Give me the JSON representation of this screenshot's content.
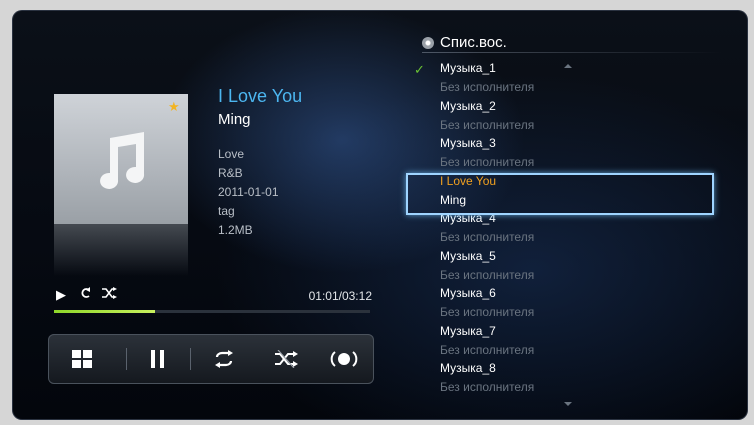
{
  "now_playing": {
    "title": "I Love You",
    "artist": "Ming",
    "album": "Love",
    "genre": "R&B",
    "date": "2011-01-01",
    "tag": "tag",
    "size": "1.2MB",
    "time_display": "01:01/03:12",
    "progress_fraction": 0.32
  },
  "status_icons": [
    "play-icon",
    "repeat-one-icon",
    "shuffle-icon"
  ],
  "controls": [
    {
      "name": "grid-view-icon"
    },
    {
      "name": "pause-icon"
    },
    {
      "name": "repeat-icon"
    },
    {
      "name": "shuffle-off-icon"
    },
    {
      "name": "sound-mode-icon"
    }
  ],
  "playlist": {
    "header": "Спис.вос.",
    "items": [
      {
        "name": "Музыка_1",
        "artist": "Без исполнителя",
        "checked": true
      },
      {
        "name": "Музыка_2",
        "artist": "Без исполнителя"
      },
      {
        "name": "Музыка_3",
        "artist": "Без исполнителя"
      },
      {
        "name": "I Love You",
        "artist": "Ming",
        "active": true
      },
      {
        "name": "Музыка_4",
        "artist": "Без исполнителя"
      },
      {
        "name": "Музыка_5",
        "artist": "Без исполнителя"
      },
      {
        "name": "Музыка_6",
        "artist": "Без исполнителя"
      },
      {
        "name": "Музыка_7",
        "artist": "Без исполнителя"
      },
      {
        "name": "Музыка_8",
        "artist": "Без исполнителя"
      }
    ]
  },
  "colors": {
    "accent_title": "#4cb6f0",
    "active_item": "#f0a020",
    "progress": "#8fd62a",
    "focus_border": "#9fd4ff",
    "check": "#6ac234"
  }
}
